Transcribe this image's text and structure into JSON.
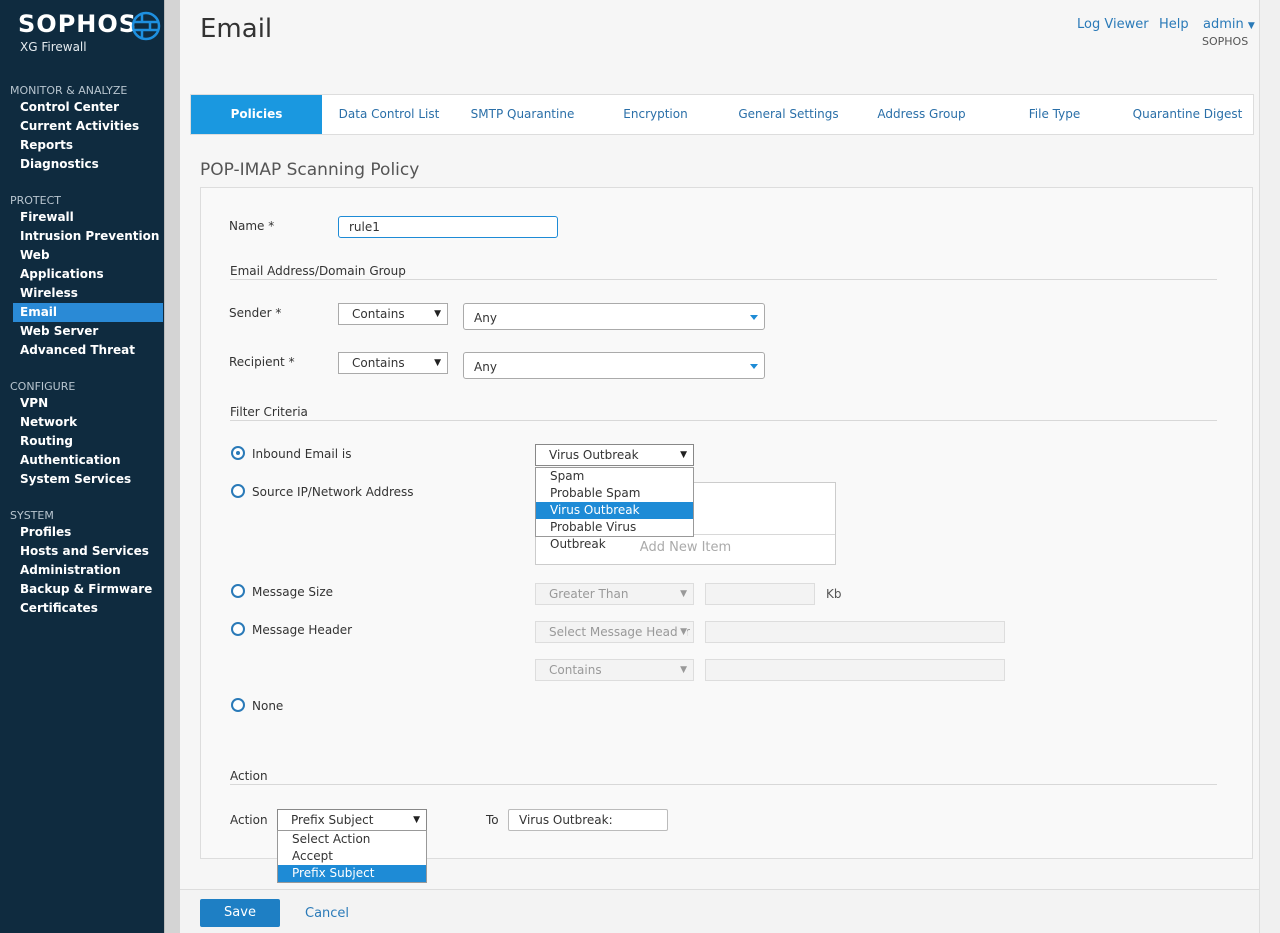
{
  "brand": {
    "name": "SOPHOS",
    "product": "XG Firewall"
  },
  "sidebar": {
    "sections": [
      {
        "title": "MONITOR & ANALYZE",
        "items": [
          "Control Center",
          "Current Activities",
          "Reports",
          "Diagnostics"
        ]
      },
      {
        "title": "PROTECT",
        "items": [
          "Firewall",
          "Intrusion Prevention",
          "Web",
          "Applications",
          "Wireless",
          "Email",
          "Web Server",
          "Advanced Threat"
        ]
      },
      {
        "title": "CONFIGURE",
        "items": [
          "VPN",
          "Network",
          "Routing",
          "Authentication",
          "System Services"
        ]
      },
      {
        "title": "SYSTEM",
        "items": [
          "Profiles",
          "Hosts and Services",
          "Administration",
          "Backup & Firmware",
          "Certificates"
        ]
      }
    ],
    "active": "Email"
  },
  "header": {
    "title": "Email",
    "log_viewer": "Log Viewer",
    "help": "Help",
    "user": "admin",
    "org": "SOPHOS"
  },
  "tabs": [
    "Policies",
    "Data Control List",
    "SMTP Quarantine",
    "Encryption",
    "General Settings",
    "Address Group",
    "File Type",
    "Quarantine Digest"
  ],
  "form": {
    "section_title": "POP-IMAP Scanning Policy",
    "name_label": "Name *",
    "name_value": "rule1",
    "address_group_heading": "Email Address/Domain Group",
    "sender_label": "Sender *",
    "sender_match": "Contains",
    "sender_value": "Any",
    "recipient_label": "Recipient *",
    "recipient_match": "Contains",
    "recipient_value": "Any",
    "filter_heading": "Filter Criteria",
    "filters": {
      "inbound": "Inbound Email is",
      "source_ip": "Source IP/Network Address",
      "message_size": "Message Size",
      "message_header": "Message Header",
      "none": "None"
    },
    "inbound_value": "Virus Outbreak",
    "inbound_options": [
      "Spam",
      "Probable Spam",
      "Virus Outbreak",
      "Probable Virus Outbreak"
    ],
    "add_new_item": "Add New Item",
    "size_operator": "Greater Than",
    "size_unit": "Kb",
    "header_select": "Select Message Header",
    "header_match": "Contains",
    "action_heading": "Action",
    "action_label": "Action",
    "action_value": "Prefix Subject",
    "action_options": [
      "Select Action",
      "Accept",
      "Prefix Subject"
    ],
    "to_label": "To",
    "to_value": "Virus Outbreak:"
  },
  "footer": {
    "save": "Save",
    "cancel": "Cancel"
  },
  "colors": {
    "sidebar_bg": "#0f2b3f",
    "accent": "#1a98e0",
    "active_nav": "#2a8ad6"
  }
}
